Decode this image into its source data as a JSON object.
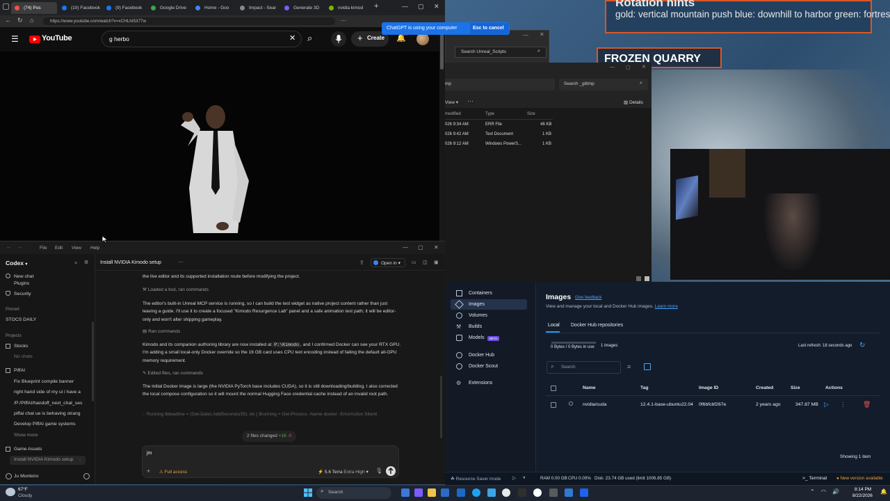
{
  "wallpaper": {
    "hint_title": "Rotation hints",
    "hint_text": "gold: vertical mountain push   blue: downhill to harbor   green: fortress-",
    "quarry_label": "FROZEN QUARRY"
  },
  "browser": {
    "tabs": [
      {
        "label": "(74) Pos",
        "color": "#ff4e45"
      },
      {
        "label": "(10) Facebook",
        "color": "#1877f2"
      },
      {
        "label": "(9) Facebook",
        "color": "#1877f2"
      },
      {
        "label": "Google Drive",
        "color": "#34a853"
      },
      {
        "label": "Home - Goo",
        "color": "#4285f4"
      },
      {
        "label": "Impact - Sear",
        "color": "#888888"
      },
      {
        "label": "Generate 3D",
        "color": "#7c5cff"
      },
      {
        "label": "nvidia kimod",
        "color": "#76b900"
      }
    ],
    "url": "https://www.youtube.com/watch?v=xCHLhI5377w",
    "youtube_logo": "YouTube",
    "search_value": "g herbo",
    "create_label": "Create",
    "notification_count": "9+"
  },
  "toast": {
    "message": "ChatGPT is using your computer",
    "cancel_label": "Esc to cancel"
  },
  "file_explorer": {
    "back_search": "Search Unreal_Scripts",
    "path": "mp",
    "search": "Search _gittmp",
    "view_label": "View",
    "details_label": "Details",
    "columns": [
      "modified",
      "Type",
      "Size"
    ],
    "rows": [
      {
        "modified": "026 9:34 AM",
        "type": "ERR File",
        "size": "46 KB"
      },
      {
        "modified": "026 9:42 AM",
        "type": "Text Document",
        "size": "1 KB"
      },
      {
        "modified": "026 9:12 AM",
        "type": "Windows PowerS...",
        "size": "1 KB"
      }
    ]
  },
  "codex": {
    "menu": [
      "File",
      "Edit",
      "View",
      "Help"
    ],
    "app_name": "Codex",
    "thread_title": "Install NVIDIA Kimodo setup",
    "open_in_label": "Open in",
    "sidebar": {
      "new_chat": "New chat",
      "plugins": "Plugins",
      "security": "Security",
      "pinned_header": "Pinned",
      "pinned": [
        "STOCS DAILY"
      ],
      "projects_header": "Projects",
      "projects": [
        {
          "name": "Stocks",
          "items": [
            "No chats"
          ]
        },
        {
          "name": "PiffAI",
          "items": [
            "Fix Blueprint compile banner",
            "right hand side of my ui i have a",
            "/P:/PiffAI/handoff_next_chat_ses",
            "piffai chat ue is behaving strang",
            "Develop PiffAI game systems"
          ]
        }
      ],
      "show_more": "Show more",
      "game_assets": "Game Assets",
      "game_assets_items": [
        "Install NVIDIA Kimodo setup"
      ],
      "user": "Ju Monteiro"
    },
    "messages": [
      {
        "kind": "text",
        "text": "the live editor and its supported installation route before modifying the project."
      },
      {
        "kind": "action",
        "text": "Loaded a tool, ran commands"
      },
      {
        "kind": "text",
        "text": "The editor's built-in Unreal MCP service is running, so I can build the test widget as native project content rather than just leaving a guide. I'll use it to create a focused \"Kimodo Resurgence Lab\" panel and a safe animation test path; it will be editor-only and won't alter shipping gameplay."
      },
      {
        "kind": "action",
        "text": "Ran commands"
      },
      {
        "kind": "text_code",
        "before": "Kimodo and its companion authoring library are now installed at ",
        "code": "P:\\Kimodo",
        "after": ", and I confirmed Docker can see your RTX GPU. I'm adding a small local-only Docker override so the 16 GB card uses CPU text encoding instead of failing the default all-GPU memory requirement."
      },
      {
        "kind": "action",
        "text": "Edited files, ran commands"
      },
      {
        "kind": "text",
        "text": "The initial Docker image is large (the NVIDIA PyTorch base includes CUDA), so it is still downloading/building. I also corrected the local compose configuration so it will mount the normal Hugging Face credential cache instead of an invalid root path."
      },
      {
        "kind": "running",
        "text": "Running $deadline = (Get-Date).AddSeconds(55); do { $running = Get-Process -Name docker -ErrorAction Silentl"
      }
    ],
    "files_changed": "2 files changed",
    "added": "+16",
    "removed": "-0",
    "composer_value": "jm",
    "access_label": "Full access",
    "model_label": "5.6 Terra",
    "effort_label": "Extra High"
  },
  "docker": {
    "nav": [
      "Containers",
      "Images",
      "Volumes",
      "Builds",
      "Models",
      "Docker Hub",
      "Docker Scout",
      "Extensions"
    ],
    "beta_badge": "BETA",
    "title": "Images",
    "feedback": "Give feedback",
    "subtitle": "View and manage your local and Docker Hub images.",
    "learn_more": "Learn more",
    "tabs": [
      "Local",
      "Docker Hub repositories"
    ],
    "usage": "0 Bytes / 0 Bytes in use",
    "image_count": "1 images",
    "last_refresh": "Last refresh: 18 seconds ago",
    "search_placeholder": "Search",
    "columns": [
      "Name",
      "Tag",
      "Image ID",
      "Created",
      "Size",
      "Actions"
    ],
    "rows": [
      {
        "name": "nvidia/cuda",
        "tag": "12.4.1-base-ubuntu22.04",
        "image_id": "0f6bfcbf267e",
        "created": "2 years ago",
        "size": "347.87 MB"
      }
    ],
    "showing": "Showing 1 item",
    "status": {
      "resource_saver": "Resource Saver mode",
      "ram": "RAM 0.00 GB",
      "cpu": "CPU 0.00%",
      "disk": "Disk: 23.74 GB used (limit 1006.85 GB)",
      "terminal": "Terminal",
      "new_version": "New version available"
    }
  },
  "taskbar": {
    "weather_temp": "67°F",
    "weather_desc": "Cloudy",
    "search_label": "Search",
    "time": "8:14 PM",
    "date": "8/22/2026"
  }
}
